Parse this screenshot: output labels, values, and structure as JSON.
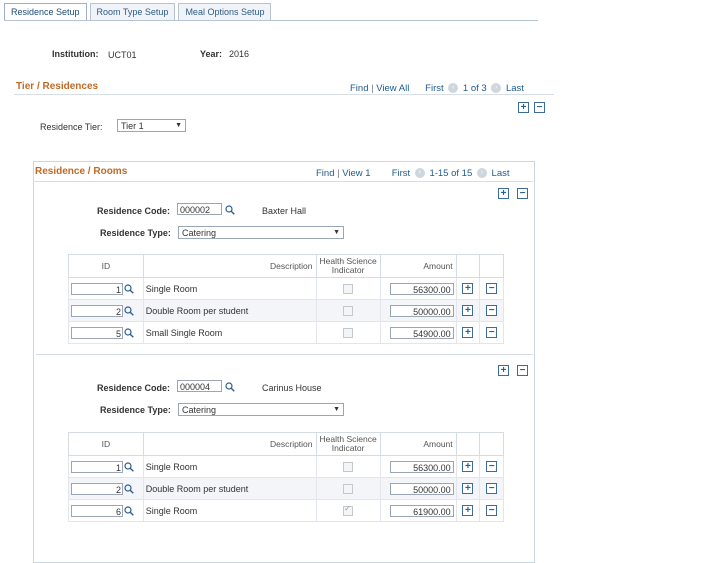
{
  "tabs": [
    {
      "label": "Residence Setup",
      "active": true
    },
    {
      "label": "Room Type Setup",
      "active": false
    },
    {
      "label": "Meal Options Setup",
      "active": false
    }
  ],
  "header": {
    "institution_label": "Institution:",
    "institution_value": "UCT01",
    "year_label": "Year:",
    "year_value": "2016"
  },
  "tier": {
    "title": "Tier / Residences",
    "find": "Find",
    "sep": "|",
    "view_all": "View All",
    "first": "First",
    "range": "1 of 3",
    "last": "Last",
    "residence_tier_label": "Residence Tier:",
    "residence_tier_value": "Tier 1"
  },
  "rooms": {
    "title": "Residence / Rooms",
    "find": "Find",
    "sep": "|",
    "view": "View 1",
    "first": "First",
    "range": "1-15 of 15",
    "last": "Last"
  },
  "columns": {
    "id": "ID",
    "description": "Description",
    "health": "Health Science Indicator",
    "amount": "Amount"
  },
  "residences": [
    {
      "code_label": "Residence Code:",
      "code": "000002",
      "name": "Baxter Hall",
      "type_label": "Residence Type:",
      "type": "Catering",
      "rows": [
        {
          "id": "1",
          "description": "Single Room",
          "health": false,
          "amount": "56300.00"
        },
        {
          "id": "2",
          "description": "Double Room per student",
          "health": false,
          "amount": "50000.00"
        },
        {
          "id": "5",
          "description": "Small Single Room",
          "health": false,
          "amount": "54900.00"
        }
      ]
    },
    {
      "code_label": "Residence Code:",
      "code": "000004",
      "name": "Carinus House",
      "type_label": "Residence Type:",
      "type": "Catering",
      "rows": [
        {
          "id": "1",
          "description": "Single Room",
          "health": false,
          "amount": "56300.00"
        },
        {
          "id": "2",
          "description": "Double Room per student",
          "health": false,
          "amount": "50000.00"
        },
        {
          "id": "6",
          "description": "Single Room",
          "health": true,
          "amount": "61900.00"
        }
      ]
    }
  ],
  "icons": {
    "add": "+",
    "remove": "−",
    "prev": "‹",
    "next": "›"
  }
}
